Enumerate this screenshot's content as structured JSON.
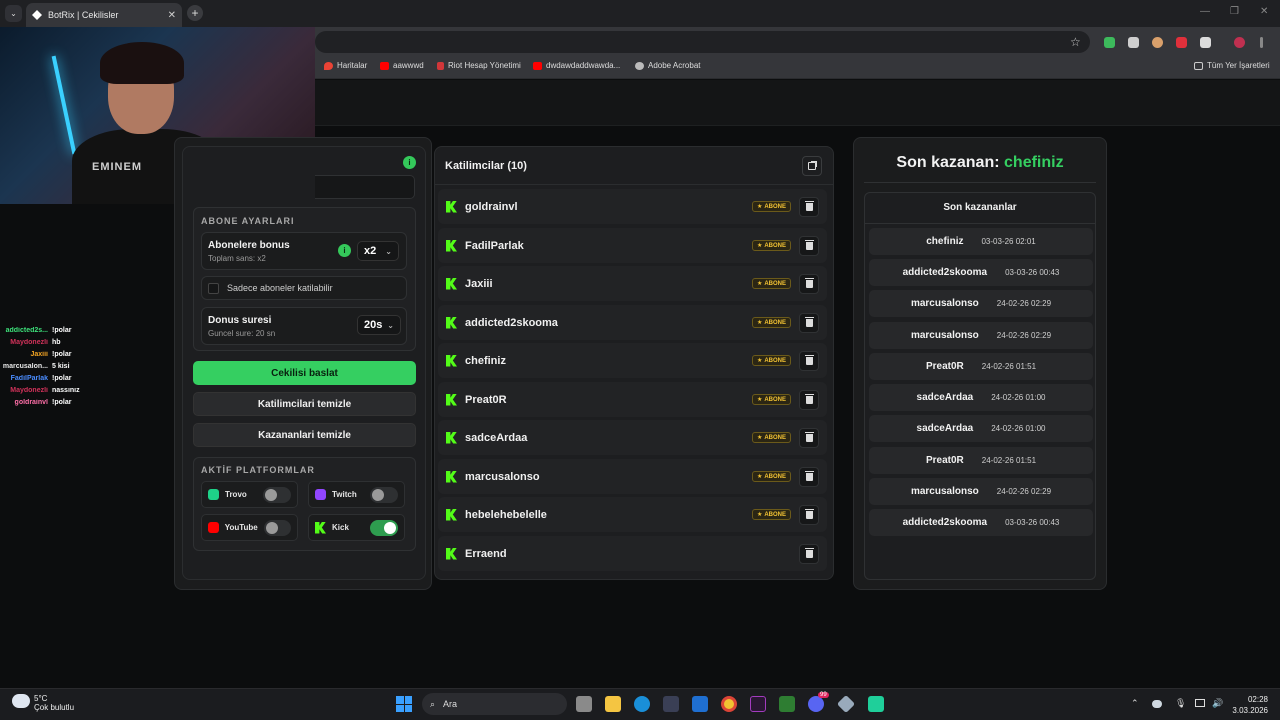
{
  "browser": {
    "tab_title": "BotRix | Cekilisler",
    "tab_close": "✕",
    "new_tab": "+",
    "tab_menu": "⌄",
    "bookmarks": [
      {
        "label": "Haritalar",
        "color": "#ea4335"
      },
      {
        "label": "aawwwd",
        "color": "#ff0000"
      },
      {
        "label": "Riot Hesap Yönetimi",
        "color": "#d13639"
      },
      {
        "label": "dwdawdaddwawda...",
        "color": "#ff0000"
      },
      {
        "label": "Adobe Acrobat",
        "color": "#cccccc"
      }
    ],
    "bookmarks_all": "Tüm Yer İşaretleri"
  },
  "stream_chat": [
    {
      "user": "addicted2s...",
      "color": "#3de07a",
      "msg": "!polar"
    },
    {
      "user": "Maydonezli",
      "color": "#d2325a",
      "msg": "hb"
    },
    {
      "user": "Jaxiii",
      "color": "#f5a623",
      "msg": "!polar"
    },
    {
      "user": "marcusalon...",
      "color": "#e8e8e8",
      "msg": "5 kisi"
    },
    {
      "user": "FadilParlak",
      "color": "#4a8cff",
      "msg": "!polar"
    },
    {
      "user": "Maydonezli",
      "color": "#d2325a",
      "msg": "nassınız"
    },
    {
      "user": "goldrainvl",
      "color": "#ff6fa8",
      "msg": "!polar"
    }
  ],
  "webcam": {
    "shirt_text": "EMINEM"
  },
  "settings": {
    "sub_section_title": "ABONE AYARLARI",
    "bonus_label": "Abonelere bonus",
    "bonus_sub": "Toplam sans: x2",
    "bonus_value": "x2",
    "only_subs_label": "Sadece aboneler katilabilir",
    "duration_label": "Donus suresi",
    "duration_sub": "Guncel sure: 20 sn",
    "duration_value": "20s",
    "start_button": "Cekilisi baslat",
    "clear_participants_button": "Katilimcilari temizle",
    "clear_winners_button": "Kazananlari temizle",
    "platforms_title": "AKTİF PLATFORMLAR",
    "platforms": [
      {
        "name": "Trovo",
        "color": "#1ed188",
        "icon": "trovo-icon",
        "on": false
      },
      {
        "name": "Twitch",
        "color": "#9146ff",
        "icon": "twitch-icon",
        "on": false
      },
      {
        "name": "YouTube",
        "color": "#ff0000",
        "icon": "youtube-icon",
        "on": false
      },
      {
        "name": "Kick",
        "color": "#53fc18",
        "icon": "kick-icon",
        "on": true
      }
    ]
  },
  "participants": {
    "title": "Katilimcilar (10)",
    "badge_label": "ABONE",
    "list": [
      {
        "name": "goldrainvl",
        "sub": true
      },
      {
        "name": "FadilParlak",
        "sub": true
      },
      {
        "name": "Jaxiii",
        "sub": true
      },
      {
        "name": "addicted2skooma",
        "sub": true
      },
      {
        "name": "chefiniz",
        "sub": true
      },
      {
        "name": "Preat0R",
        "sub": true
      },
      {
        "name": "sadceArdaa",
        "sub": true
      },
      {
        "name": "marcusalonso",
        "sub": true
      },
      {
        "name": "hebelehebelelle",
        "sub": true
      },
      {
        "name": "Erraend",
        "sub": false
      }
    ]
  },
  "winner": {
    "label": "Son kazanan:",
    "name": "chefiniz",
    "accent": "#35cf61"
  },
  "winners": {
    "title": "Son kazananlar",
    "list": [
      {
        "name": "chefiniz",
        "date": "03-03-26 02:01"
      },
      {
        "name": "addicted2skooma",
        "date": "03-03-26 00:43"
      },
      {
        "name": "marcusalonso",
        "date": "24-02-26 02:29"
      },
      {
        "name": "marcusalonso",
        "date": "24-02-26 02:29"
      },
      {
        "name": "Preat0R",
        "date": "24-02-26 01:51"
      },
      {
        "name": "sadceArdaa",
        "date": "24-02-26 01:00"
      },
      {
        "name": "sadceArdaa",
        "date": "24-02-26 01:00"
      },
      {
        "name": "Preat0R",
        "date": "24-02-26 01:51"
      },
      {
        "name": "marcusalonso",
        "date": "24-02-26 02:29"
      },
      {
        "name": "addicted2skooma",
        "date": "03-03-26 00:43"
      }
    ]
  },
  "taskbar": {
    "weather_temp": "5°C",
    "weather_desc": "Çok bulutlu",
    "search_placeholder": "Ara",
    "time": "02:28",
    "date": "3.03.2026",
    "discord_badge": "99"
  }
}
